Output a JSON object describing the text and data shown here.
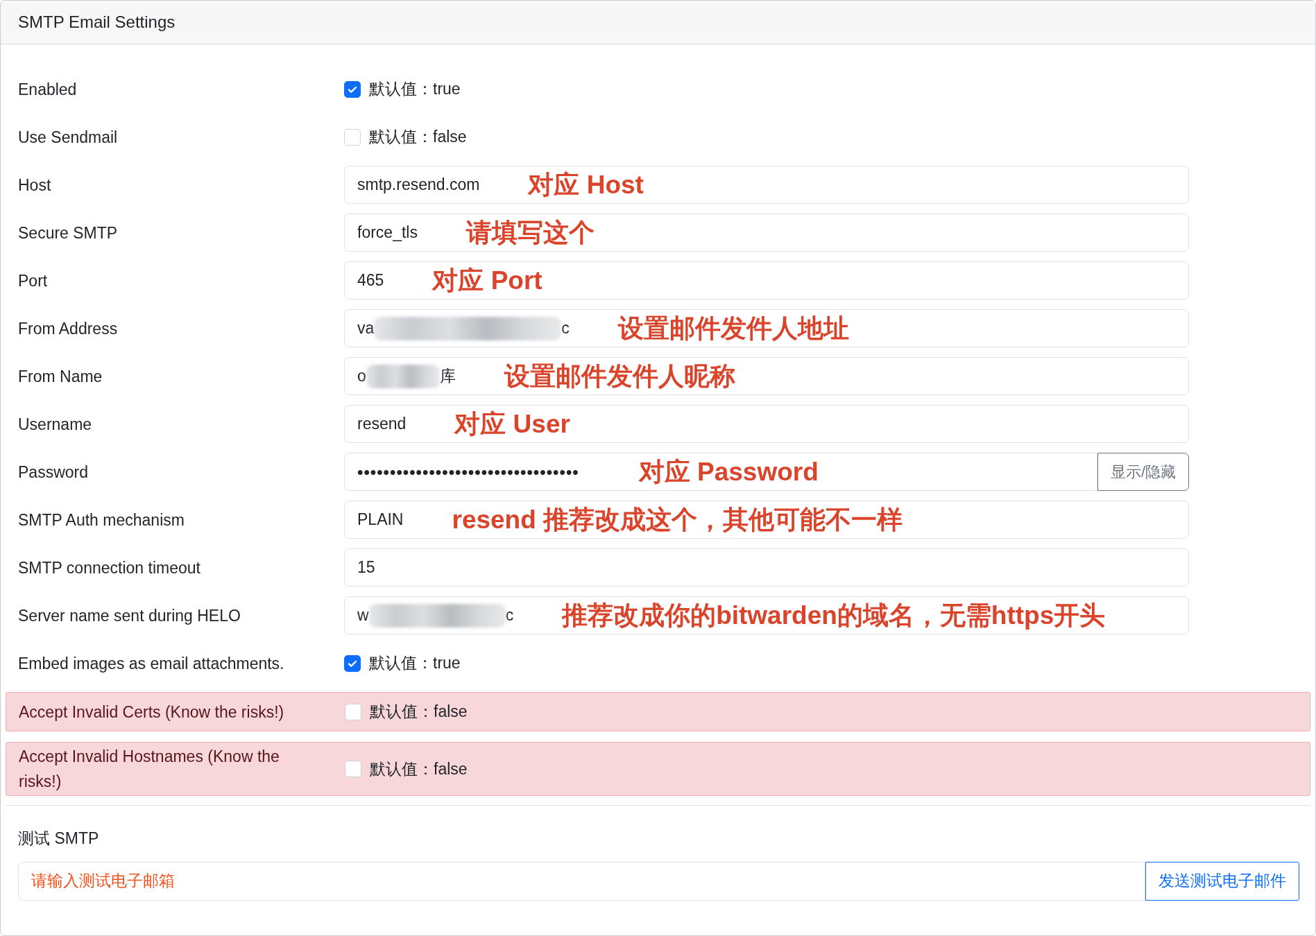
{
  "card": {
    "title": "SMTP Email Settings"
  },
  "rows": [
    {
      "kind": "checkbox",
      "label": "Enabled",
      "checked": true,
      "hint": "默认值：true"
    },
    {
      "kind": "checkbox",
      "label": "Use Sendmail",
      "checked": false,
      "hint": "默认值：false"
    },
    {
      "kind": "text",
      "label": "Host",
      "value": "smtp.resend.com",
      "annotation": "对应 Host"
    },
    {
      "kind": "text",
      "label": "Secure SMTP",
      "value": "force_tls",
      "annotation": "请填写这个"
    },
    {
      "kind": "text",
      "label": "Port",
      "value": "465",
      "annotation": "对应 Port"
    },
    {
      "kind": "redacted",
      "label": "From Address",
      "value_start": "va",
      "value_end": "c",
      "annotation": "设置邮件发件人地址"
    },
    {
      "kind": "redacted",
      "label": "From Name",
      "value_start": "o",
      "value_end": "库",
      "annotation": "设置邮件发件人昵称"
    },
    {
      "kind": "text",
      "label": "Username",
      "value": "resend",
      "annotation": "对应 User"
    },
    {
      "kind": "password",
      "label": "Password",
      "value": "••••••••••••••••••••••••••••••••••",
      "annotation": "对应 Password",
      "button": "显示/隐藏"
    },
    {
      "kind": "text",
      "label": "SMTP Auth mechanism",
      "value": "PLAIN",
      "annotation": "resend 推荐改成这个，其他可能不一样"
    },
    {
      "kind": "text",
      "label": "SMTP connection timeout",
      "value": "15"
    },
    {
      "kind": "redacted",
      "label": "Server name sent during HELO",
      "value_start": "w",
      "value_end": "c",
      "annotation": "推荐改成你的bitwarden的域名，无需https开头"
    },
    {
      "kind": "checkbox",
      "label": "Embed images as email attachments.",
      "checked": true,
      "hint": "默认值：true"
    },
    {
      "kind": "danger_checkbox",
      "label": "Accept Invalid Certs (Know the risks!)",
      "checked": false,
      "hint": "默认值：false"
    },
    {
      "kind": "danger_checkbox",
      "label": "Accept Invalid Hostnames (Know the risks!)",
      "checked": false,
      "hint": "默认值：false"
    }
  ],
  "test": {
    "label": "测试 SMTP",
    "placeholder": "请输入测试电子邮箱",
    "button": "发送测试电子邮件"
  }
}
